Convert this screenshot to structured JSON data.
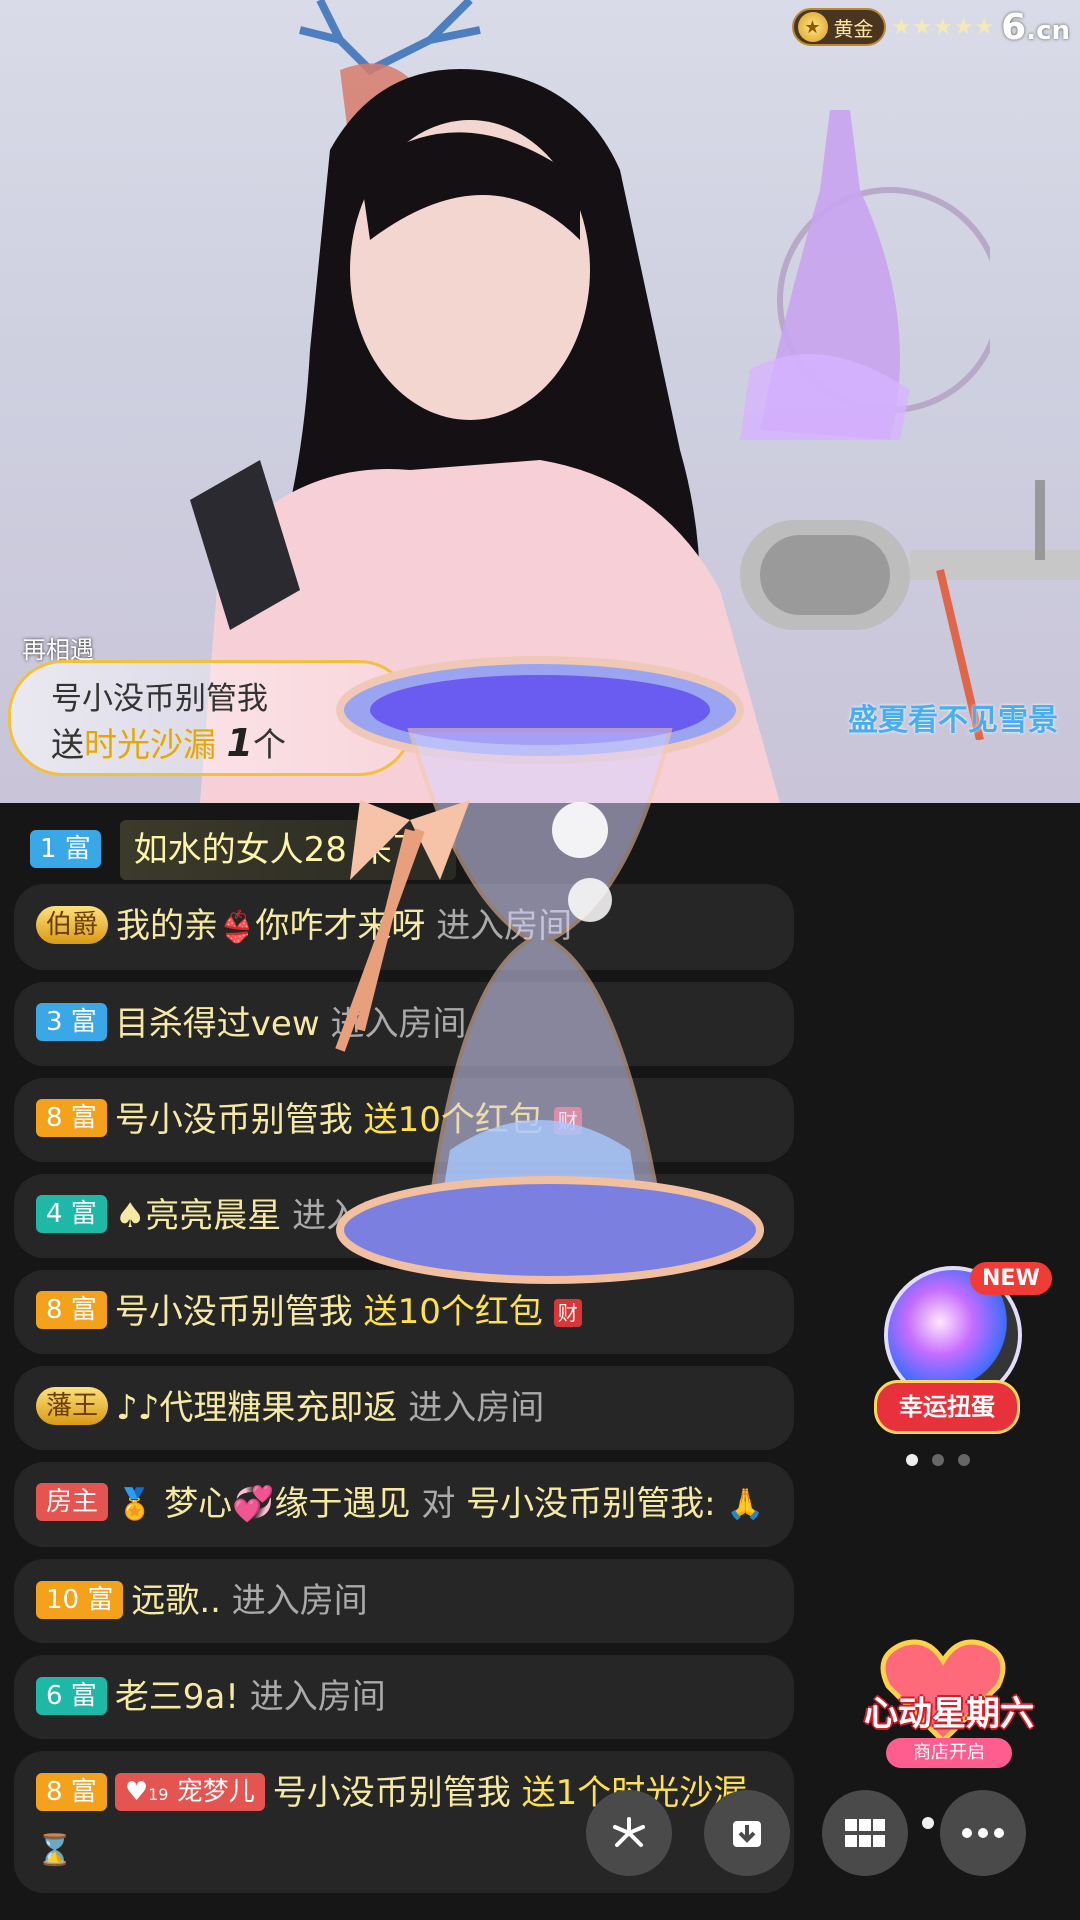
{
  "header": {
    "rank_label": "黄金",
    "stars": "★★★★★",
    "logo_main": "6",
    "logo_suffix": ".cn"
  },
  "stream": {
    "song_left": "再相遇",
    "song_right": "盛夏看不见雪景"
  },
  "gift_banner": {
    "sender": "号小没币别管我",
    "send_word": "送",
    "gift_name": "时光沙漏",
    "count": "1",
    "unit": "个"
  },
  "chat": {
    "top_notice": {
      "badge": "1 富",
      "text": "如水的女人28 来了"
    },
    "messages": [
      {
        "badge": "伯爵",
        "name": "我的亲",
        "name2": "你咋才来呀",
        "action": "进入房间"
      },
      {
        "badge": "3 富",
        "prefix": "目",
        "name": "杀得过vew",
        "action": "进入房间"
      },
      {
        "badge": "8 富",
        "name": "号小没币别管我",
        "action": "送10个红包",
        "tag": "财"
      },
      {
        "badge": "4 富",
        "prefix": "♠",
        "name": "亮亮晨星",
        "action": "进入房间"
      },
      {
        "badge": "8 富",
        "name": "号小没币别管我",
        "action": "送10个红包",
        "tag": "财"
      },
      {
        "badge": "藩王",
        "prefix": "♪♪",
        "name": "代理糖果充即返",
        "action": "进入房间"
      },
      {
        "badge": "房主",
        "name": "梦心💞缘于遇见",
        "mid": "对",
        "target": "号小没币别管我:",
        "emoji": "🙏"
      },
      {
        "badge": "10 富",
        "name": "远歌..",
        "action": "进入房间"
      },
      {
        "badge": "6 富",
        "name": "老三9a!",
        "action": "进入房间"
      },
      {
        "badge": "8 富",
        "pet": "宠梦儿",
        "pet_level": "19",
        "name": "号小没币别管我",
        "action": "送1个时光沙漏"
      }
    ]
  },
  "side": {
    "gacha_new": "NEW",
    "gacha_label": "幸运扭蛋",
    "promo_title": "心动星期六",
    "promo_sub": "商店开启"
  },
  "toolbar": {
    "share_icon": "share-icon",
    "download_icon": "download-icon",
    "grid_icon": "grid-icon",
    "more_icon": "more-icon"
  }
}
